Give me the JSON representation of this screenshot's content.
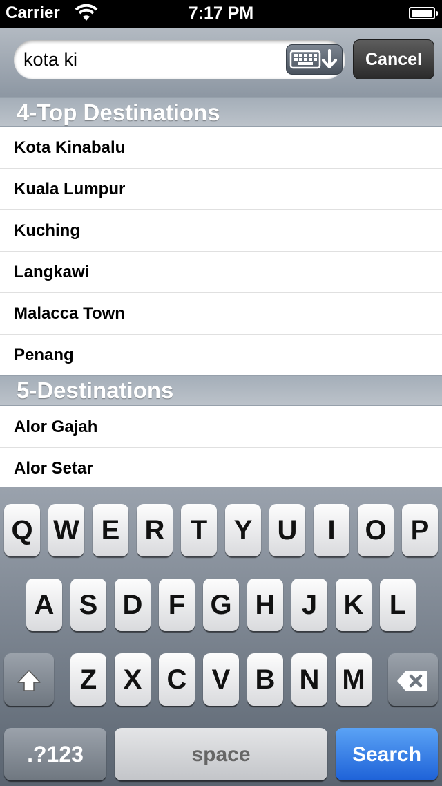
{
  "status_bar": {
    "carrier": "Carrier",
    "time": "7:17 PM"
  },
  "search": {
    "value": "kota ki",
    "cancel_label": "Cancel"
  },
  "sections": [
    {
      "title": "4-Top Destinations",
      "items": [
        "Kota Kinabalu",
        "Kuala Lumpur",
        "Kuching",
        "Langkawi",
        "Malacca Town",
        "Penang"
      ]
    },
    {
      "title": "5-Destinations",
      "items": [
        "Alor Gajah",
        "Alor Setar"
      ]
    }
  ],
  "keyboard": {
    "row1": [
      "Q",
      "W",
      "E",
      "R",
      "T",
      "Y",
      "U",
      "I",
      "O",
      "P"
    ],
    "row2": [
      "A",
      "S",
      "D",
      "F",
      "G",
      "H",
      "J",
      "K",
      "L"
    ],
    "row3": [
      "Z",
      "X",
      "C",
      "V",
      "B",
      "N",
      "M"
    ],
    "numbers_label": ".?123",
    "space_label": "space",
    "search_label": "Search",
    "shift_icon": "shift-icon",
    "delete_icon": "delete-icon"
  },
  "colors": {
    "search_key": "#2f7be8",
    "status_bar": "#000000",
    "header_text": "#ffffff"
  }
}
